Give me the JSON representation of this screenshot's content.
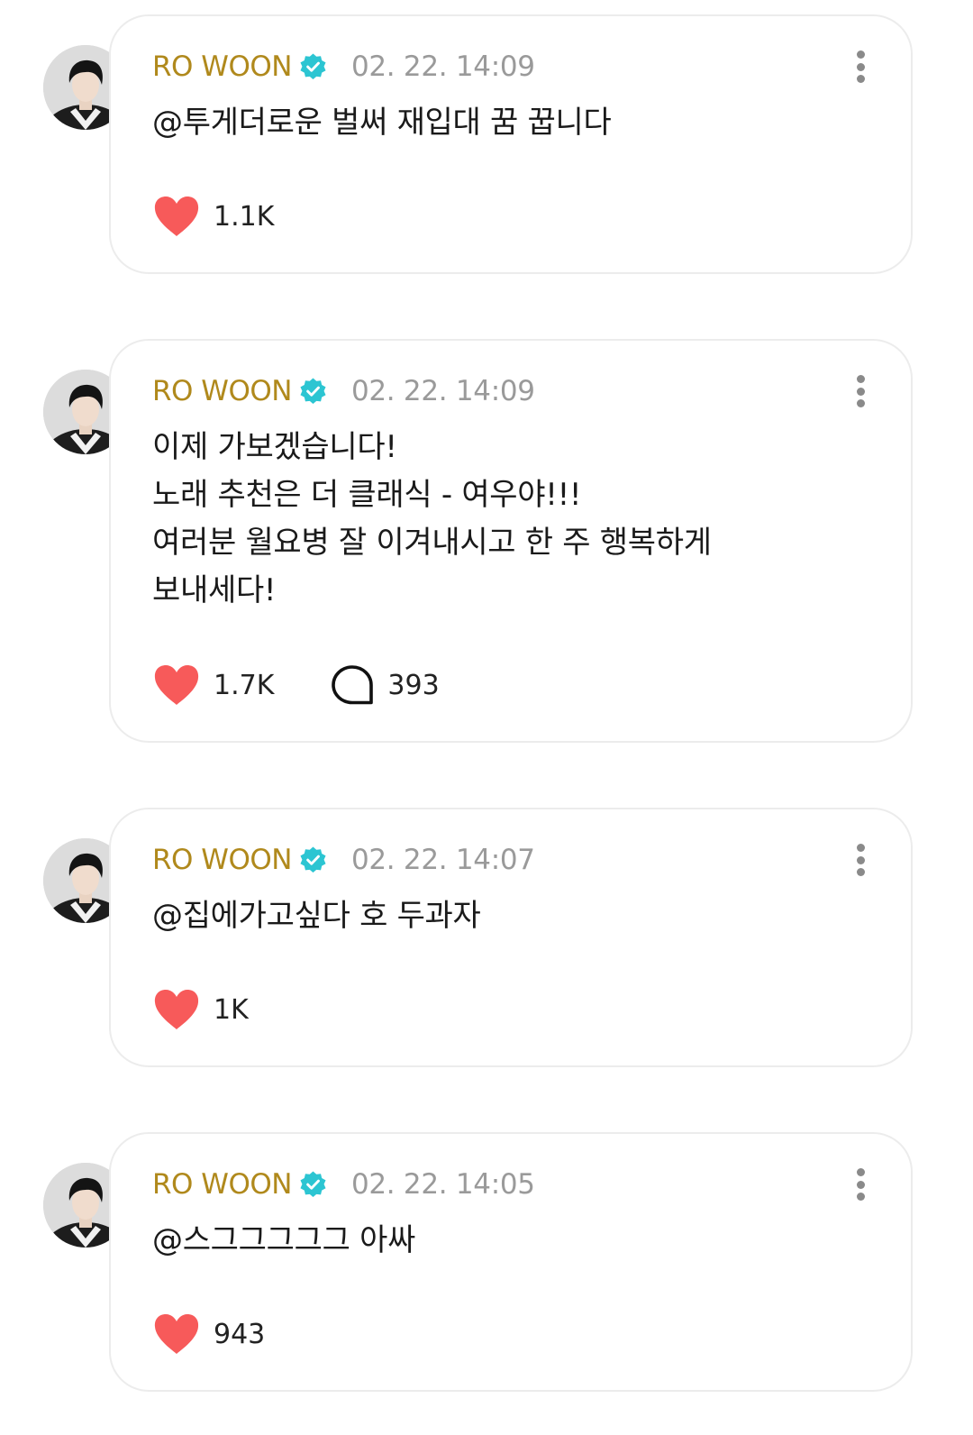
{
  "colors": {
    "author": "#b0891c",
    "timestamp": "#9a9a9a",
    "verified_badge": "#2cc5d2",
    "heart": "#f75a5a",
    "card_border": "#ececec"
  },
  "icons": {
    "verified": "verified-badge-icon",
    "more": "more-vertical-icon",
    "like": "heart-icon",
    "comment": "comment-bubble-icon"
  },
  "posts": [
    {
      "author": "RO WOON",
      "time": "02. 22. 14:09",
      "text": "@투게더로운 벌써 재입대 꿈 꿉니다",
      "likes": "1.1K"
    },
    {
      "author": "RO WOON",
      "time": "02. 22. 14:09",
      "text": "이제 가보겠습니다!\n노래 추천은 더 클래식 - 여우야!!!\n여러분 월요병 잘 이겨내시고 한 주 행복하게\n보내세다!",
      "likes": "1.7K",
      "comments": "393"
    },
    {
      "author": "RO WOON",
      "time": "02. 22. 14:07",
      "text": "@집에가고싶다 호 두과자",
      "likes": "1K"
    },
    {
      "author": "RO WOON",
      "time": "02. 22. 14:05",
      "text": "@스그그그그그 아싸",
      "likes": "943"
    }
  ]
}
